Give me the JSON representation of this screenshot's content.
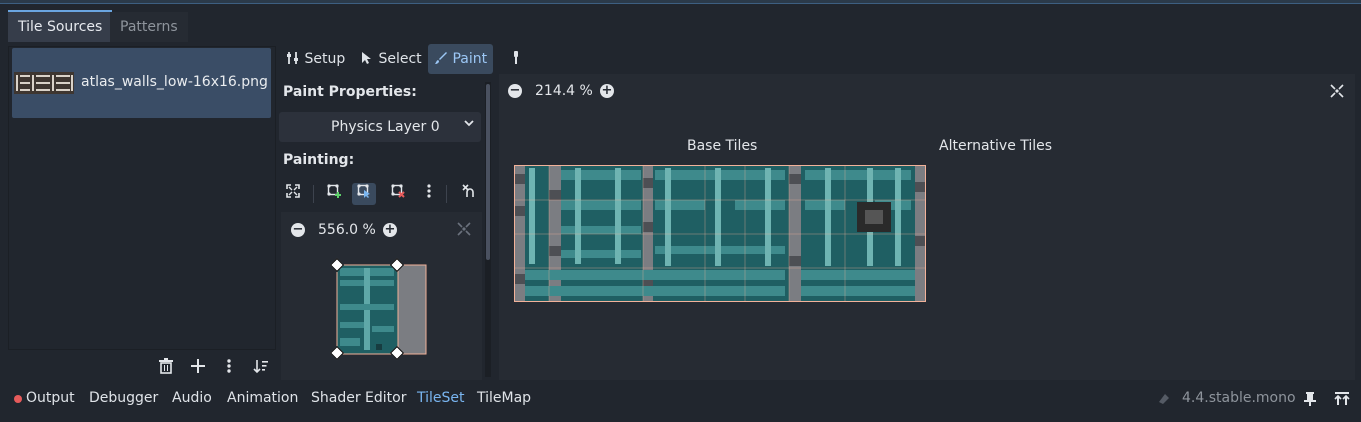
{
  "tabs": [
    {
      "label": "Tile Sources",
      "active": true
    },
    {
      "label": "Patterns",
      "active": false
    }
  ],
  "source": {
    "file_label": "atlas_walls_low-16x16.png"
  },
  "modes": {
    "setup": "Setup",
    "select": "Select",
    "paint": "Paint"
  },
  "paint_properties": {
    "label": "Paint Properties:",
    "selected": "Physics Layer 0",
    "painting_label": "Painting:"
  },
  "preview": {
    "zoom": "556.0 %"
  },
  "atlas_view": {
    "zoom": "214.4 %",
    "base_tiles_label": "Base Tiles",
    "alt_tiles_label": "Alternative Tiles"
  },
  "bottom": {
    "items": [
      "Output",
      "Debugger",
      "Audio",
      "Animation",
      "Shader Editor",
      "TileSet",
      "TileMap"
    ],
    "active": "TileSet",
    "version": "4.4.stable.mono"
  },
  "colors": {
    "accent": "#6aa5e0",
    "selection_bg": "#3a4d66",
    "tile_border": "#f2b29a",
    "tile_teal": "#1f5f63",
    "error_dot": "#e65b5b"
  },
  "icons": [
    "trash-icon",
    "plus-icon",
    "kebab-icon",
    "sort-icon",
    "setup-icon",
    "cursor-icon",
    "paint-brush-icon",
    "picker-icon",
    "zoom-out-icon",
    "zoom-in-icon",
    "center-view-icon",
    "expand-icon",
    "terrain-add-icon",
    "terrain-select-icon",
    "terrain-remove-icon",
    "kebab-icon",
    "clear-icon",
    "pin-icon",
    "panel-toggle-icon"
  ]
}
